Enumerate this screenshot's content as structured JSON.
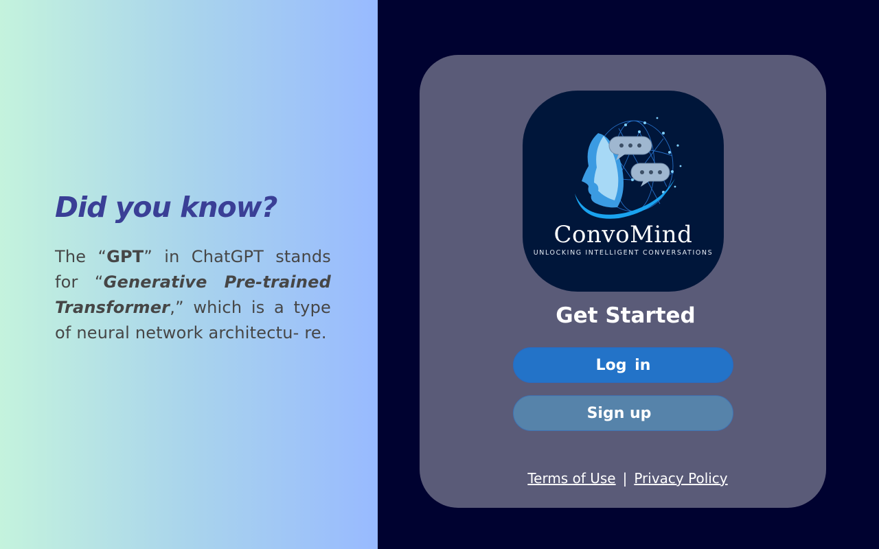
{
  "fact": {
    "title": "Did you know?",
    "p1": "The “",
    "gpt": "GPT",
    "p2": "” in ChatGPT stands for “",
    "expansion": "Generative Pre-trained Transformer",
    "p3": ",” which is a type of neural network architectu- re."
  },
  "logo": {
    "wordmark": "ConvoMind",
    "tagline": "UNLOCKING INTELLIGENT CONVERSATIONS"
  },
  "card": {
    "heading": "Get Started",
    "login_label": "Log in",
    "signup_label": "Sign up"
  },
  "footer": {
    "terms_label": "Terms of Use",
    "separator": "|",
    "privacy_label": "Privacy Policy"
  },
  "colors": {
    "title_purple": "#3a3f96",
    "right_bg": "#000230",
    "card_bg": "#5a5b78",
    "login_button": "#2373c8",
    "signup_button": "#5683aa"
  }
}
